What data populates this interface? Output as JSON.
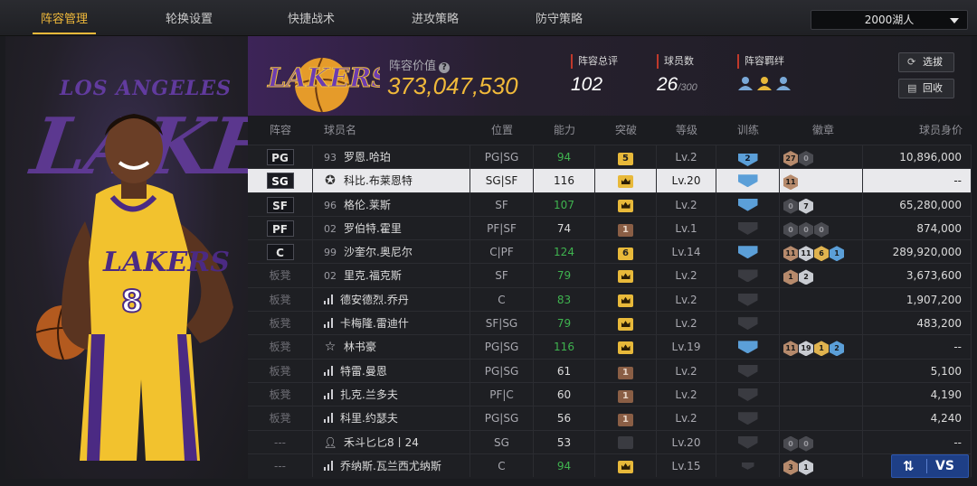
{
  "tabs": [
    {
      "label": "阵容管理",
      "active": true
    },
    {
      "label": "轮换设置"
    },
    {
      "label": "快捷战术"
    },
    {
      "label": "进攻策略"
    },
    {
      "label": "防守策略"
    }
  ],
  "team_select": {
    "value": "2000湖人"
  },
  "art": {
    "text_top": "LOS ANGELES",
    "text_big": "LAKERS"
  },
  "header": {
    "logo_text": "LAKERS",
    "value_label": "阵容价值",
    "value": "373,047,530",
    "stats": {
      "rating_label": "阵容总评",
      "rating": "102",
      "players_label": "球员数",
      "players": "26",
      "players_max": "/300",
      "bond_label": "阵容羁绊"
    },
    "buttons": {
      "scout": "选拔",
      "recycle": "回收"
    }
  },
  "columns": [
    "阵容",
    "球员名",
    "位置",
    "能力",
    "突破",
    "等级",
    "训练",
    "徽章",
    "球员身价"
  ],
  "rows": [
    {
      "slot": "PG",
      "num": "93",
      "name": "罗恩.哈珀",
      "pos": "PG|SG",
      "ovr": "94",
      "ovr_green": true,
      "brk": "5",
      "brk_type": "gold",
      "lvl": "Lv.2",
      "trn": "2",
      "trn_type": "blue",
      "badges": [
        {
          "t": "bronze",
          "v": "27"
        },
        {
          "t": "dark",
          "v": "0"
        }
      ],
      "salary": "10,896,000"
    },
    {
      "slot": "SG",
      "num": "",
      "icon": "star",
      "name": "科比.布莱恩特",
      "pos": "SG|SF",
      "ovr": "116",
      "ovr_green": false,
      "brk": "",
      "brk_type": "gold",
      "lvl": "Lv.20",
      "trn": "",
      "trn_type": "blue",
      "badges": [
        {
          "t": "bronze",
          "v": "11"
        }
      ],
      "salary": "--",
      "selected": true
    },
    {
      "slot": "SF",
      "num": "96",
      "name": "格伦.莱斯",
      "pos": "SF",
      "ovr": "107",
      "ovr_green": true,
      "brk": "",
      "brk_type": "gold",
      "lvl": "Lv.2",
      "trn": "",
      "trn_type": "blue",
      "badges": [
        {
          "t": "dark",
          "v": "0"
        },
        {
          "t": "silver",
          "v": "7"
        }
      ],
      "salary": "65,280,000"
    },
    {
      "slot": "PF",
      "num": "02",
      "name": "罗伯特.霍里",
      "pos": "PF|SF",
      "ovr": "74",
      "ovr_green": false,
      "brk": "1",
      "brk_type": "brown",
      "lvl": "Lv.1",
      "trn": "",
      "trn_type": "dark",
      "badges": [
        {
          "t": "dark",
          "v": "0"
        },
        {
          "t": "dark",
          "v": "0"
        },
        {
          "t": "dark",
          "v": "0"
        }
      ],
      "salary": "874,000"
    },
    {
      "slot": "C",
      "num": "99",
      "name": "沙奎尔.奥尼尔",
      "pos": "C|PF",
      "ovr": "124",
      "ovr_green": true,
      "brk": "6",
      "brk_type": "gold",
      "lvl": "Lv.14",
      "trn": "",
      "trn_type": "blue",
      "badges": [
        {
          "t": "bronze",
          "v": "11"
        },
        {
          "t": "silver",
          "v": "11"
        },
        {
          "t": "gold",
          "v": "6"
        },
        {
          "t": "blue",
          "v": "1"
        }
      ],
      "salary": "289,920,000"
    },
    {
      "slot": "板凳",
      "num": "02",
      "name": "里克.福克斯",
      "pos": "SF",
      "ovr": "79",
      "ovr_green": true,
      "brk": "",
      "brk_type": "gold",
      "lvl": "Lv.2",
      "trn": "",
      "trn_type": "dark",
      "badges": [
        {
          "t": "bronze",
          "v": "1"
        },
        {
          "t": "silver",
          "v": "2"
        }
      ],
      "salary": "3,673,600"
    },
    {
      "slot": "板凳",
      "num": "",
      "icon": "signal",
      "name": "德安德烈.乔丹",
      "pos": "C",
      "ovr": "83",
      "ovr_green": true,
      "brk": "",
      "brk_type": "gold",
      "lvl": "Lv.2",
      "trn": "",
      "trn_type": "dark",
      "badges": [],
      "salary": "1,907,200"
    },
    {
      "slot": "板凳",
      "num": "",
      "icon": "signal",
      "name": "卡梅隆.雷迪什",
      "pos": "SF|SG",
      "ovr": "79",
      "ovr_green": true,
      "brk": "",
      "brk_type": "gold",
      "lvl": "Lv.2",
      "trn": "",
      "trn_type": "dark",
      "badges": [],
      "salary": "483,200"
    },
    {
      "slot": "板凳",
      "num": "",
      "icon": "star-outline",
      "name": "林书豪",
      "pos": "PG|SG",
      "ovr": "116",
      "ovr_green": true,
      "brk": "",
      "brk_type": "gold",
      "lvl": "Lv.19",
      "trn": "",
      "trn_type": "blue",
      "badges": [
        {
          "t": "bronze",
          "v": "11"
        },
        {
          "t": "silver",
          "v": "19"
        },
        {
          "t": "gold",
          "v": "1"
        },
        {
          "t": "blue",
          "v": "2"
        }
      ],
      "salary": "--"
    },
    {
      "slot": "板凳",
      "num": "",
      "icon": "signal",
      "name": "特雷.曼恩",
      "pos": "PG|SG",
      "ovr": "61",
      "ovr_green": false,
      "brk": "1",
      "brk_type": "brown",
      "lvl": "Lv.2",
      "trn": "",
      "trn_type": "dark",
      "badges": [],
      "salary": "5,100"
    },
    {
      "slot": "板凳",
      "num": "",
      "icon": "signal",
      "name": "扎克.兰多夫",
      "pos": "PF|C",
      "ovr": "60",
      "ovr_green": false,
      "brk": "1",
      "brk_type": "brown",
      "lvl": "Lv.2",
      "trn": "",
      "trn_type": "dark",
      "badges": [],
      "salary": "4,190"
    },
    {
      "slot": "板凳",
      "num": "",
      "icon": "signal",
      "name": "科里.约瑟夫",
      "pos": "PG|SG",
      "ovr": "56",
      "ovr_green": false,
      "brk": "1",
      "brk_type": "brown",
      "lvl": "Lv.2",
      "trn": "",
      "trn_type": "dark",
      "badges": [],
      "salary": "4,240"
    },
    {
      "slot": "---",
      "num": "",
      "icon": "person",
      "name": "禾斗匕匕8丨24",
      "pos": "SG",
      "ovr": "53",
      "ovr_green": false,
      "brk": "",
      "brk_type": "gray",
      "lvl": "Lv.20",
      "trn": "",
      "trn_type": "dark",
      "badges": [
        {
          "t": "dark",
          "v": "0"
        },
        {
          "t": "dark",
          "v": "0"
        }
      ],
      "salary": "--"
    },
    {
      "slot": "---",
      "num": "",
      "icon": "signal",
      "name": "乔纳斯.瓦兰西尤纳斯",
      "pos": "C",
      "ovr": "94",
      "ovr_green": true,
      "brk": "",
      "brk_type": "gold",
      "lvl": "Lv.15",
      "trn": "",
      "trn_type": "tiny",
      "badges": [
        {
          "t": "bronze",
          "v": "3"
        },
        {
          "t": "silver",
          "v": "1"
        }
      ],
      "salary": ""
    }
  ],
  "vs_button": {
    "swap": "⇅",
    "label": "VS"
  },
  "colors": {
    "accent": "#f0b93a",
    "green": "#3fb34f",
    "blue": "#5b9fd8",
    "lakers_purple": "#552583"
  }
}
